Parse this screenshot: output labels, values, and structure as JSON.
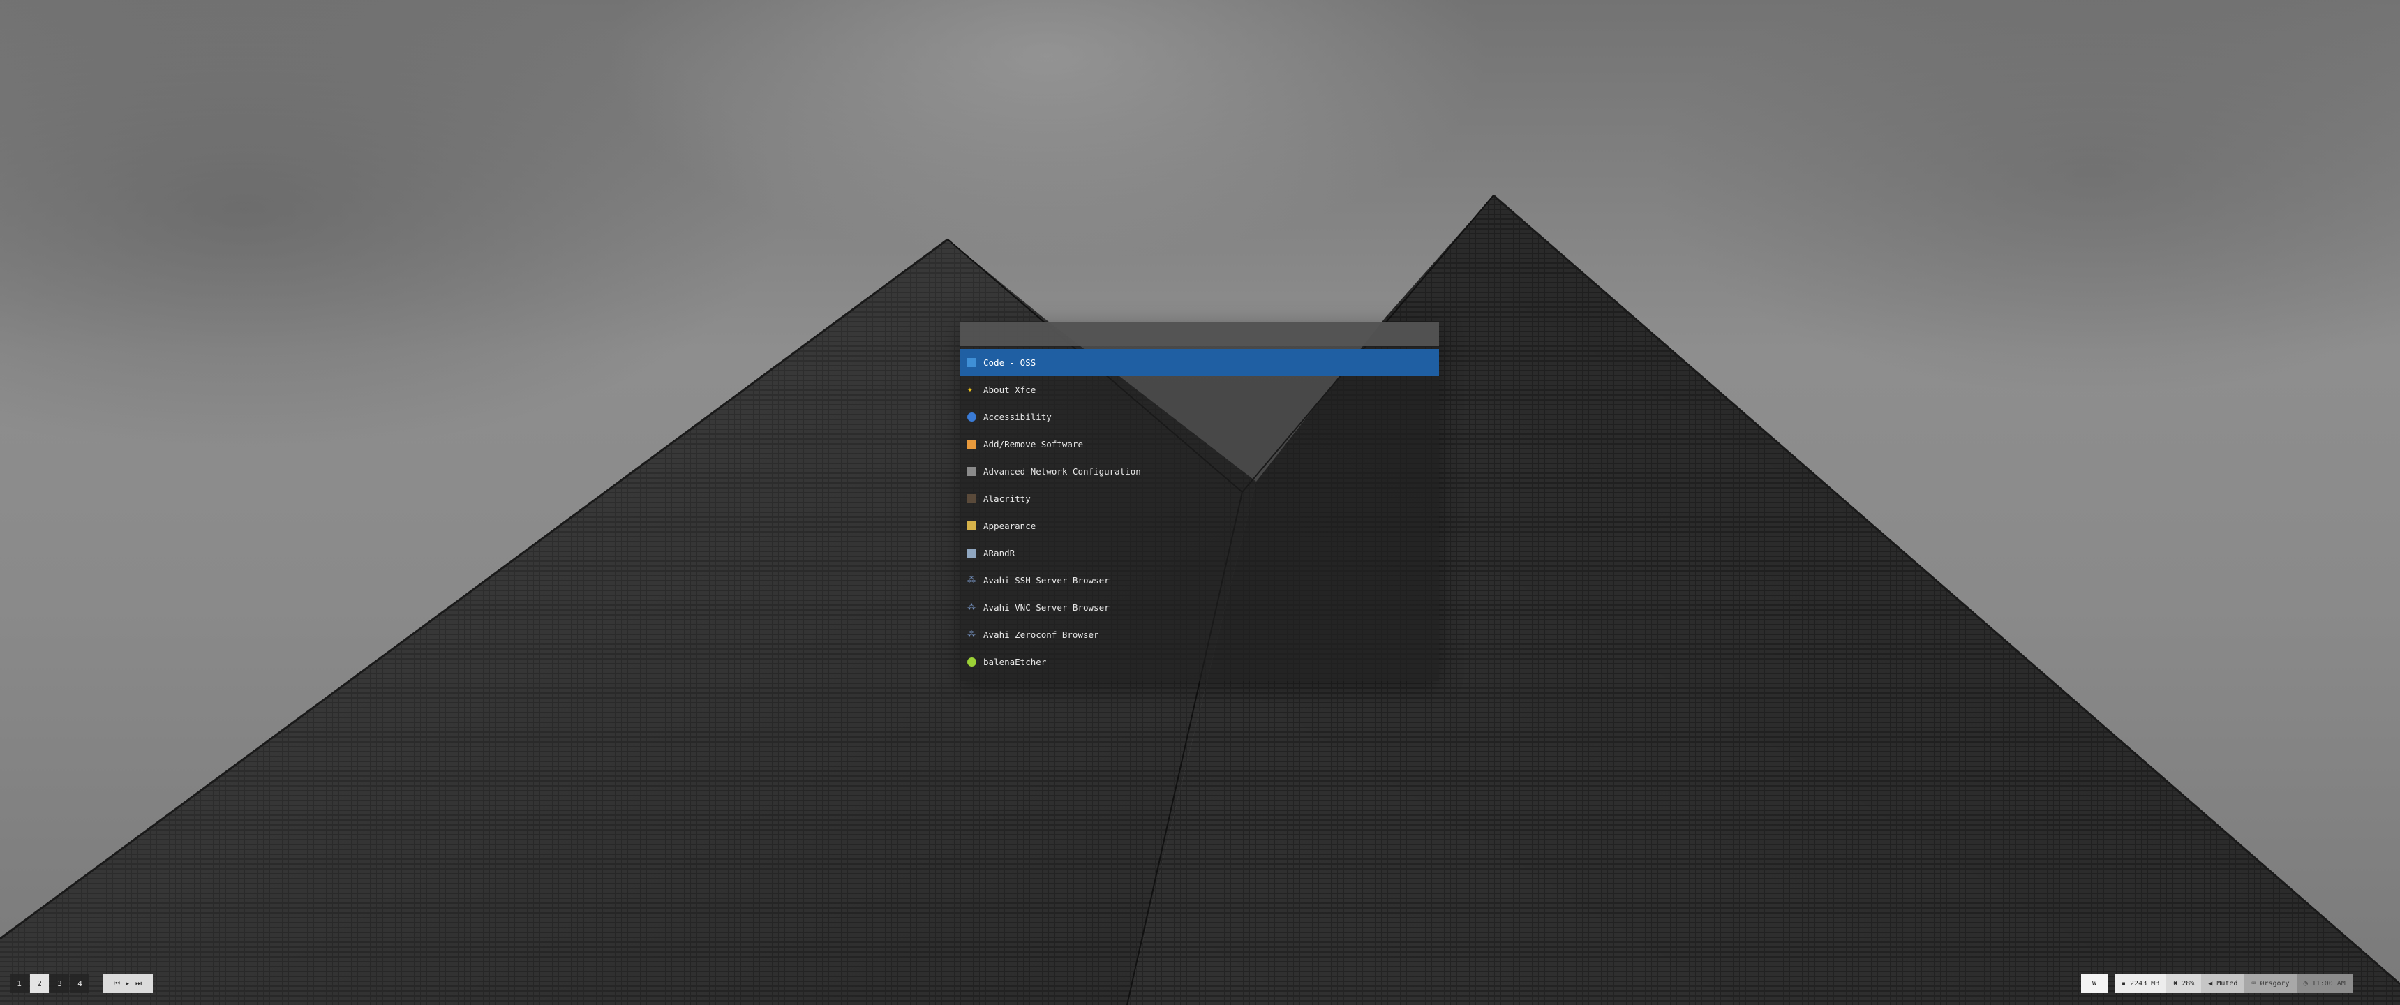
{
  "launcher": {
    "search_value": "",
    "items": [
      {
        "label": "Code - OSS",
        "icon": "code-oss-icon",
        "color": "#3f8fd6",
        "selected": true
      },
      {
        "label": "About Xfce",
        "icon": "xfce-star-icon",
        "color": "#f0c419",
        "selected": false
      },
      {
        "label": "Accessibility",
        "icon": "accessibility-icon",
        "color": "#3a7bd5",
        "selected": false
      },
      {
        "label": "Add/Remove Software",
        "icon": "package-icon",
        "color": "#e89a3c",
        "selected": false
      },
      {
        "label": "Advanced Network Configuration",
        "icon": "network-icon",
        "color": "#8a8a8a",
        "selected": false
      },
      {
        "label": "Alacritty",
        "icon": "terminal-icon",
        "color": "#5a4a3a",
        "selected": false
      },
      {
        "label": "Appearance",
        "icon": "appearance-icon",
        "color": "#d6b24a",
        "selected": false
      },
      {
        "label": "ARandR",
        "icon": "display-icon",
        "color": "#8fa6c0",
        "selected": false
      },
      {
        "label": "Avahi SSH Server Browser",
        "icon": "avahi-icon",
        "color": "#7d9ccf",
        "selected": false
      },
      {
        "label": "Avahi VNC Server Browser",
        "icon": "avahi-icon",
        "color": "#7d9ccf",
        "selected": false
      },
      {
        "label": "Avahi Zeroconf Browser",
        "icon": "avahi-icon",
        "color": "#7d9ccf",
        "selected": false
      },
      {
        "label": "balenaEtcher",
        "icon": "etcher-icon",
        "color": "#9bd136",
        "selected": false
      }
    ]
  },
  "bar": {
    "workspaces": [
      {
        "label": "1",
        "active": false
      },
      {
        "label": "2",
        "active": true
      },
      {
        "label": "3",
        "active": false
      },
      {
        "label": "4",
        "active": false
      }
    ],
    "mpd": {
      "prev": "⏮",
      "play": "▸",
      "next": "⏭"
    },
    "window_label": "W",
    "memory": "2243 MB",
    "battery": "28%",
    "volume": "Muted",
    "keyboard": "Ørsgory",
    "clock": "11:00 AM",
    "colors": {
      "accent": "#1f5fa3",
      "active_workspace": "#e4e4e4"
    }
  }
}
